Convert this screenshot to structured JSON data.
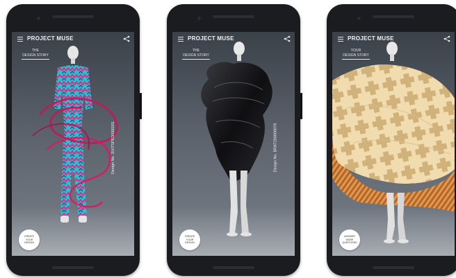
{
  "screens": [
    {
      "brand": "PROJECT MUSE",
      "story_line1": "THE",
      "story_line2": "DESIGN STORY",
      "design_no": "Design No. SUITSPEDI000261",
      "cta_lines": [
        "CREATE",
        "YOUR",
        "DESIGN"
      ]
    },
    {
      "brand": "PROJECT MUSE",
      "story_line1": "THE",
      "story_line2": "DESIGN STORY",
      "design_no": "Design No. BRAT200000078",
      "cta_lines": [
        "CREATE",
        "YOUR",
        "DESIGN"
      ]
    },
    {
      "brand": "PROJECT MUSE",
      "story_line1": "YOUR",
      "story_line2": "DESIGN STORY",
      "design_no": "",
      "cta_lines": [
        "ANSWER",
        "MORE",
        "QUESTIONS"
      ]
    }
  ],
  "colors": {
    "phone_body": "#1b1c1f",
    "backdrop": "#5b626b",
    "outfit1_cyan": "#27c3d4",
    "outfit1_magenta": "#c63f8f",
    "outfit2_black": "#141416",
    "outfit3_cream": "#f1dcb0",
    "outfit3_pattern": "#d0b27a",
    "outfit3_orange": "#c8742e"
  },
  "icons": [
    "menu-icon",
    "share-icon"
  ]
}
